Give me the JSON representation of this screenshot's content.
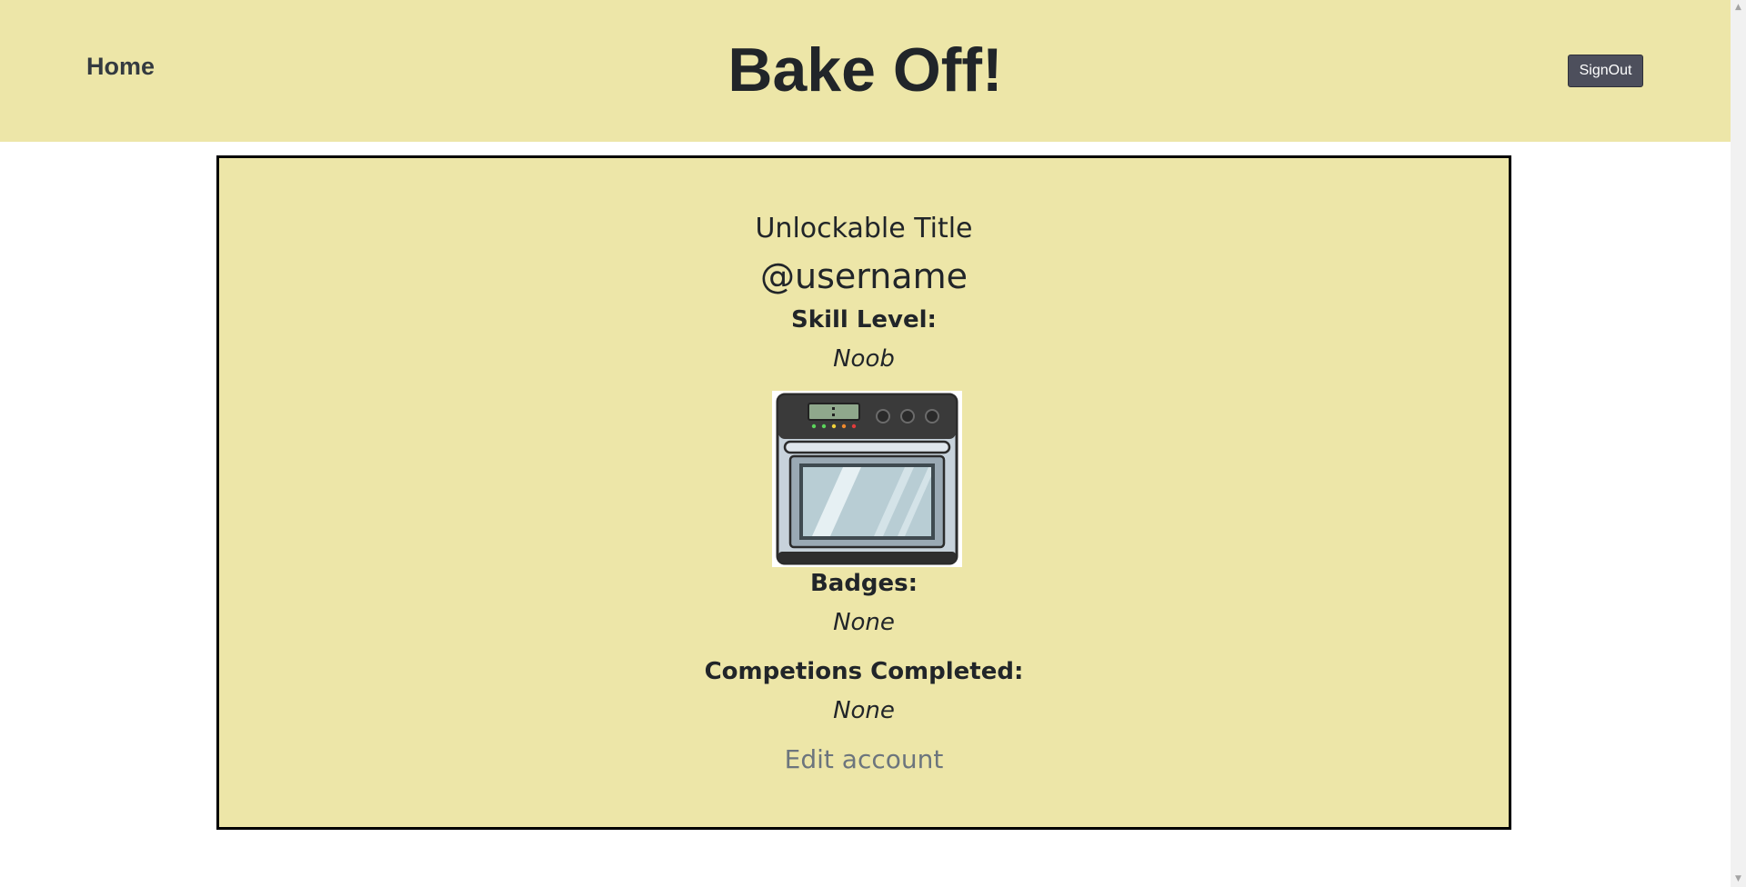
{
  "header": {
    "home_label": "Home",
    "site_title": "Bake Off!",
    "signout_label": "SignOut"
  },
  "profile": {
    "unlockable_title": "Unlockable Title",
    "username": "@username",
    "skill_label": "Skill Level:",
    "skill_value": "Noob",
    "avatar_icon": "oven-icon",
    "badges_label": "Badges:",
    "badges_value": "None",
    "competitions_label": "Competions Completed:",
    "competitions_value": "None",
    "edit_label": "Edit account"
  },
  "colors": {
    "header_bg": "#ede6a8",
    "card_bg": "#ede6a8",
    "button_bg": "#4d4f5c",
    "link_muted": "#6c757d"
  },
  "scrollbar": {
    "up_icon": "scroll-up-arrow-icon",
    "down_icon": "scroll-down-arrow-icon"
  }
}
